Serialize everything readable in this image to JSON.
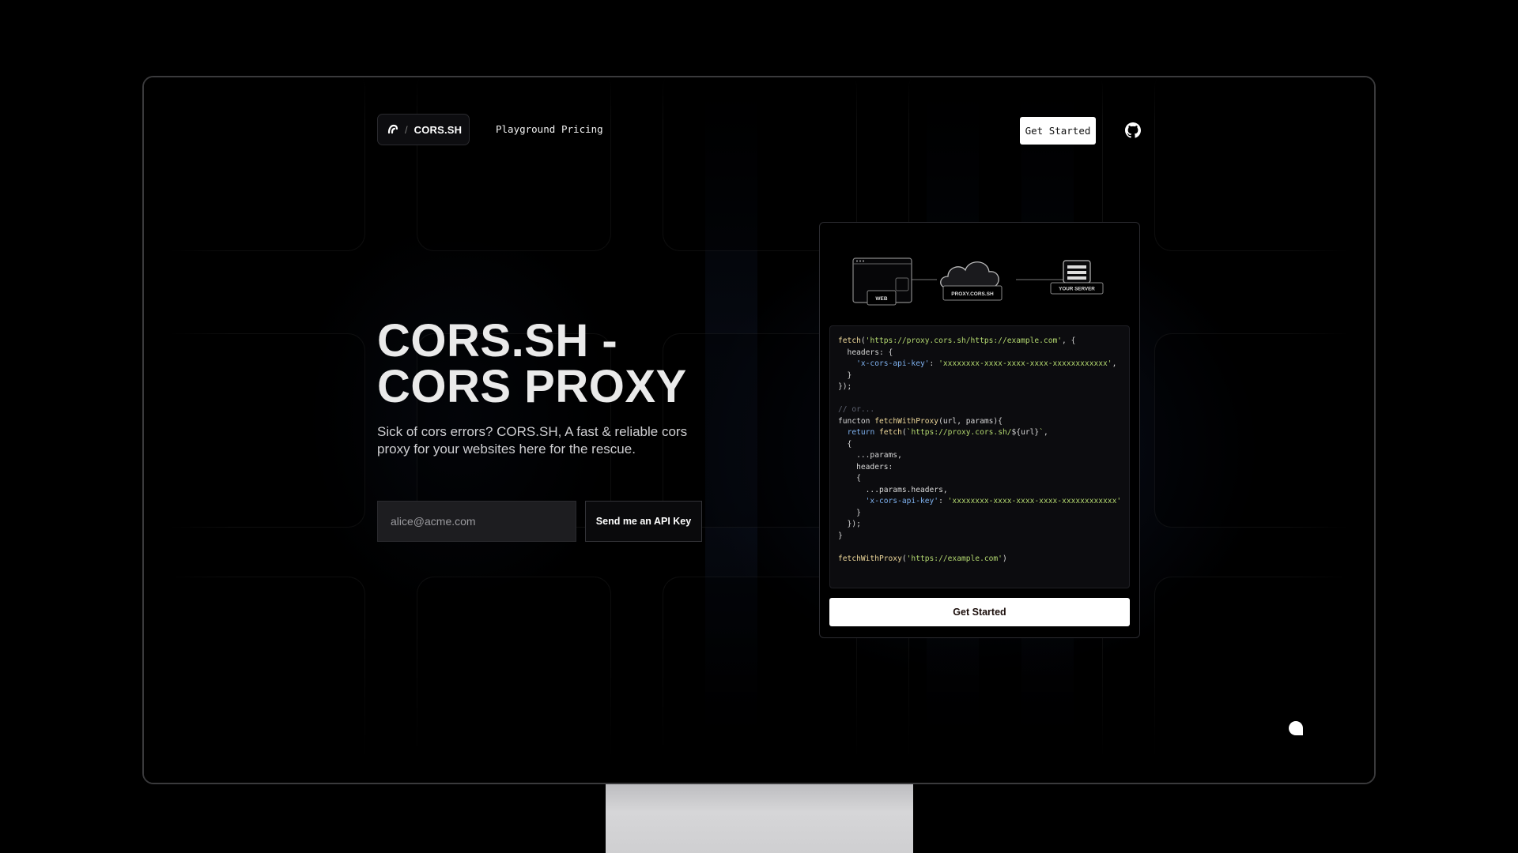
{
  "brand": {
    "separator": "/",
    "name": "CORS.SH",
    "logo_icon": "cors-logo-icon"
  },
  "nav": {
    "links": [
      "Playground",
      "Pricing"
    ],
    "cta_label": "Get Started",
    "github_icon": "github-icon"
  },
  "hero": {
    "title": "CORS.SH - CORS PROXY",
    "subtitle": "Sick of cors errors? CORS.SH, A fast & reliable cors proxy for your websites here for the rescue.",
    "email_placeholder": "alice@acme.com",
    "submit_label": "Send me an API Key"
  },
  "diagram": {
    "labels": [
      "WEB",
      "PROXY.CORS.SH",
      "YOUR SERVER"
    ]
  },
  "code": {
    "lines": [
      [
        [
          "fn",
          "fetch"
        ],
        [
          "p",
          "("
        ],
        [
          "str",
          "'https://proxy.cors.sh/https://example.com'"
        ],
        [
          "p",
          ", {"
        ]
      ],
      [
        [
          "p",
          "  headers: {"
        ]
      ],
      [
        [
          "p",
          "    "
        ],
        [
          "kw",
          "'x-cors-api-key'"
        ],
        [
          "p",
          ": "
        ],
        [
          "str",
          "'xxxxxxxx-xxxx-xxxx-xxxx-xxxxxxxxxxxx'"
        ],
        [
          "p",
          ","
        ]
      ],
      [
        [
          "p",
          "  }"
        ]
      ],
      [
        [
          "p",
          "});"
        ]
      ],
      [
        [
          "p",
          ""
        ]
      ],
      [
        [
          "com",
          "// or..."
        ]
      ],
      [
        [
          "p",
          "functon "
        ],
        [
          "fn",
          "fetchWithProxy"
        ],
        [
          "p",
          "(url, params){"
        ]
      ],
      [
        [
          "p",
          "  "
        ],
        [
          "kw",
          "return"
        ],
        [
          "p",
          " "
        ],
        [
          "fn",
          "fetch"
        ],
        [
          "p",
          "("
        ],
        [
          "str",
          "`https://proxy.cors.sh/"
        ],
        [
          "p",
          "${url}"
        ],
        [
          "str",
          "`"
        ],
        [
          "p",
          ","
        ]
      ],
      [
        [
          "p",
          "  {"
        ]
      ],
      [
        [
          "p",
          "    ...params,"
        ]
      ],
      [
        [
          "p",
          "    headers:"
        ]
      ],
      [
        [
          "p",
          "    {"
        ]
      ],
      [
        [
          "p",
          "      ...params.headers,"
        ]
      ],
      [
        [
          "p",
          "      "
        ],
        [
          "kw",
          "'x-cors-api-key'"
        ],
        [
          "p",
          ": "
        ],
        [
          "str",
          "'xxxxxxxx-xxxx-xxxx-xxxx-xxxxxxxxxxxx'"
        ]
      ],
      [
        [
          "p",
          "    }"
        ]
      ],
      [
        [
          "p",
          "  });"
        ]
      ],
      [
        [
          "p",
          "}"
        ]
      ],
      [
        [
          "p",
          ""
        ]
      ],
      [
        [
          "fn",
          "fetchWithProxy"
        ],
        [
          "p",
          "("
        ],
        [
          "str",
          "'https://example.com'"
        ],
        [
          "p",
          ")"
        ]
      ]
    ]
  },
  "card": {
    "cta_label": "Get Started"
  },
  "widgets": {
    "chat_icon": "chat-bubble-icon"
  }
}
